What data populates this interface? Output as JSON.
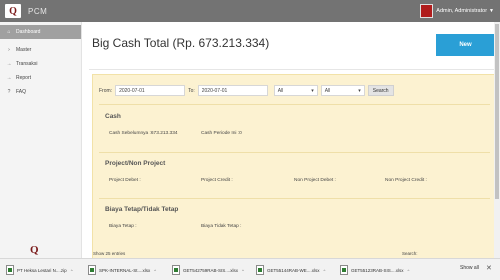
{
  "app": {
    "logo_letter": "Q",
    "title": "PCM"
  },
  "user": {
    "name": "Admin, Administrator",
    "caret": "▼"
  },
  "sidebar": {
    "items": [
      {
        "icon": "home-icon",
        "glyph": "⌂",
        "label": "Dashboard",
        "active": true
      },
      {
        "icon": "chevron-right-icon",
        "glyph": "›",
        "label": "Master"
      },
      {
        "icon": "arrow-right-icon",
        "glyph": "→",
        "label": "Transaksi"
      },
      {
        "icon": "arrow-right-icon",
        "glyph": "→",
        "label": "Report"
      },
      {
        "icon": "question-icon",
        "glyph": "?",
        "label": "FAQ"
      }
    ],
    "footer_logo": "Q"
  },
  "main": {
    "title": "Big Cash Total (Rp. 673.213.334)",
    "new_button": "New"
  },
  "filter": {
    "from_label": "From:",
    "from_value": "2020-07-01",
    "to_label": "To:",
    "to_value": "2020-07-01",
    "select1_value": "All",
    "select2_value": "All",
    "search_button": "Search"
  },
  "sections": {
    "cash": {
      "title": "Cash",
      "sebelumnya": "Cash Sebelumnya :673.213.334",
      "periode_ini": "Cash Periode Ini :0"
    },
    "project": {
      "title": "Project/Non Project",
      "project_debet": "Project Debet :",
      "project_credit": "Project Credit :",
      "non_project_debet": "Non Project Debet :",
      "non_project_credit": "Non Project Credit :"
    },
    "biaya": {
      "title": "Biaya Tetap/Tidak Tetap",
      "biaya_tetap": "Biaya Tetap :",
      "biaya_tidak_tetap": "Biaya Tidak Tetap :"
    }
  },
  "table": {
    "show_entries": "Show 25 entries",
    "search_label": "Search:"
  },
  "downloads": {
    "items": [
      "PT Heksa Lestari N....zip",
      "SPK-INTERNAL-St....xlsx",
      "GET542759RAB-SIS....xlsx",
      "GET55144RAB-WE....xlsx",
      "GET55123RAB-SIS....xlsx"
    ],
    "show_all": "Show all",
    "close": "✕"
  }
}
